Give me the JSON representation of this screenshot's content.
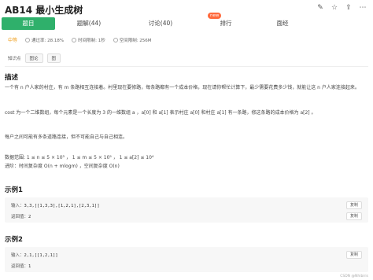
{
  "header": {
    "title": "AB14  最小生成树",
    "icons": [
      "edit-icon",
      "star-icon",
      "share-icon",
      "more-icon"
    ]
  },
  "tabs": [
    {
      "label": "题目"
    },
    {
      "label": "题解(44)"
    },
    {
      "label": "讨论(40)"
    },
    {
      "label": "排行"
    },
    {
      "label": "面经"
    }
  ],
  "new_badge": "new",
  "meta": {
    "difficulty": "中等",
    "pass_rate": "通过率: 28.18%",
    "time_limit": "时间限制: 1秒",
    "space_limit": "空间限制: 256M"
  },
  "knowledge": {
    "label": "知识点",
    "tags": [
      "图论",
      "图"
    ]
  },
  "description": {
    "heading": "描述",
    "p1": "一个有 n 户人家的村庄，有 m 条路相互连接着。村里现在要修路，每条路都有一个成本价格，现在请你帮忙计算下，最少需要花费多少钱，就能让这 n 户人家连接起来。",
    "p2": "cost 为一个二维数组，每个元素是一个长度为 3 的一维数组 a ，a[0] 和 a[1] 表示村庄 a[0] 和村庄 a[1] 有一条路，修这条路的成本价格为 a[2] 。",
    "p3": "每户之间可能有多条道路连接，但不可能自己与自己相连。",
    "p4": "数据范围: 1 ≤ n ≤ 5 × 10³ ， 1 ≤ m ≤ 5 × 10⁵ ， 1 ≤ a[2] ≤ 10⁴",
    "p5": "进阶：时间复杂度 O(n + mlogm) ，空间复杂度 O(n)"
  },
  "examples": [
    {
      "heading": "示例1",
      "input_label": "输入：",
      "input": "3,3,[[1,3,3],[1,2,1],[2,3,1]]",
      "output_label": "返回值：",
      "output": "2",
      "copy": "复制"
    },
    {
      "heading": "示例2",
      "input_label": "输入：",
      "input": "2,1,[[1,2,1]]",
      "output_label": "返回值：",
      "output": "1",
      "copy": "复制"
    }
  ],
  "watermark": "CSDN @Nhibiris"
}
